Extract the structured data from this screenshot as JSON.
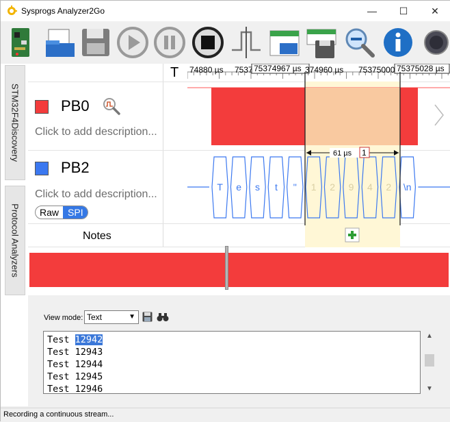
{
  "window": {
    "title": "Sysprogs Analyzer2Go",
    "minimize": "—",
    "maximize": "☐",
    "close": "✕"
  },
  "toolbar": {
    "items": [
      "board-icon",
      "open-icon",
      "save-icon",
      "play-icon",
      "pause-icon",
      "stop-icon",
      "trigger-icon",
      "load-view-icon",
      "save-view-icon",
      "zoom-out-icon",
      "info-icon",
      "record-icon"
    ]
  },
  "side_tabs": {
    "device": "STM32F4Discovery",
    "protocols": "Protocol Analyzers"
  },
  "timeline": {
    "t_label": "T",
    "ticks": [
      "74880 µs",
      "7537",
      "75374967 µs",
      "374960 µs",
      "75375000",
      "75375028 µs"
    ]
  },
  "channels": [
    {
      "name": "PB0",
      "color": "#f33c3c",
      "description": "Click to add description..."
    },
    {
      "name": "PB2",
      "color": "#3b78f0",
      "description": "Click to add description..."
    }
  ],
  "decoder_toggle": {
    "raw": "Raw",
    "spi": "SPI"
  },
  "spi_bytes": [
    "T",
    "e",
    "s",
    "t",
    "''",
    "1",
    "2",
    "9",
    "4",
    "2",
    "\\n"
  ],
  "measurement": {
    "duration": "61 µs",
    "marker": "1"
  },
  "notes": {
    "label": "Notes",
    "add": "+"
  },
  "view_mode": {
    "label": "View mode:",
    "value": "Text"
  },
  "output": {
    "lines": [
      {
        "prefix": "Test ",
        "value": "12942",
        "selected": true
      },
      {
        "prefix": "Test ",
        "value": "12943",
        "selected": false
      },
      {
        "prefix": "Test ",
        "value": "12944",
        "selected": false
      },
      {
        "prefix": "Test ",
        "value": "12945",
        "selected": false
      },
      {
        "prefix": "Test ",
        "value": "12946",
        "selected": false
      }
    ]
  },
  "status": "Recording a continuous stream..."
}
